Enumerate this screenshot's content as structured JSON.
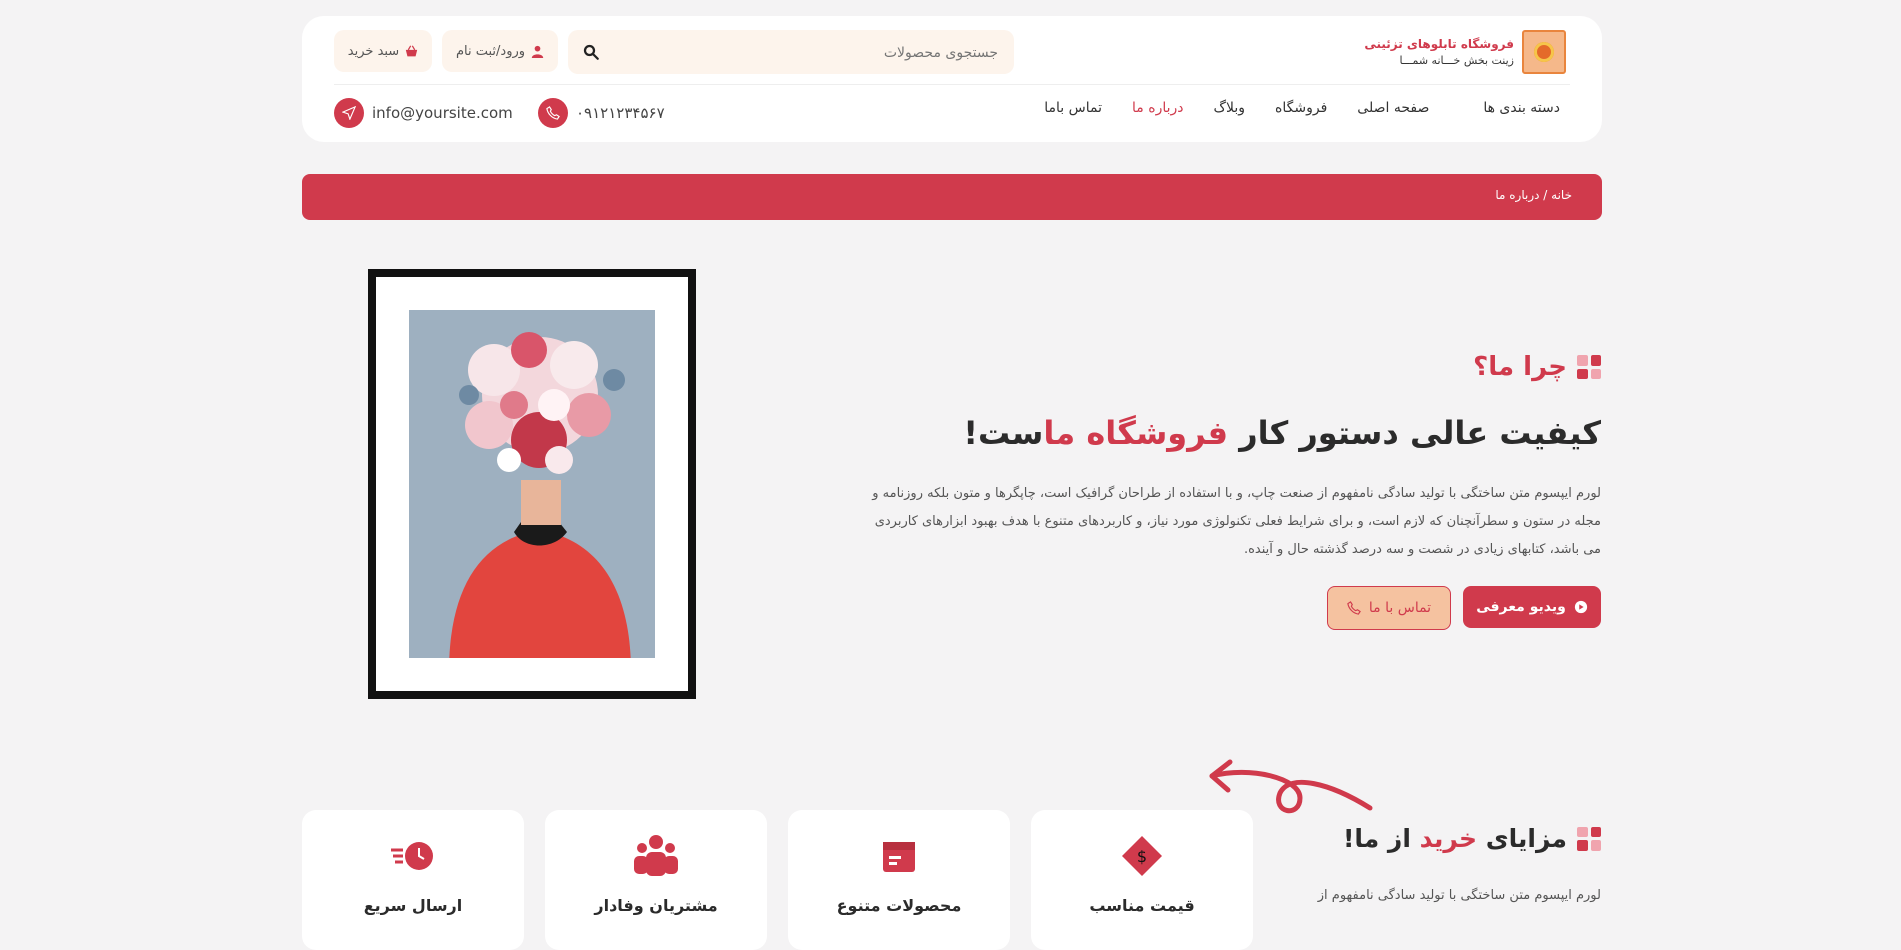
{
  "header": {
    "logo_title": "فروشگاه تابلوهای تزئینی",
    "logo_subtitle": "زینت بخش خـــانه شمـــا",
    "search_placeholder": "جستجوی محصولات",
    "login_label": "ورود/ثبت نام",
    "cart_label": "سبد خرید",
    "nav": [
      {
        "label": "دسته بندی ها",
        "active": false
      },
      {
        "label": "صفحه اصلی",
        "active": false
      },
      {
        "label": "فروشگاه",
        "active": false
      },
      {
        "label": "وبلاگ",
        "active": false
      },
      {
        "label": "درباره ما",
        "active": true
      },
      {
        "label": "تماس باما",
        "active": false
      }
    ],
    "phone": "۰۹۱۲۱۲۳۴۵۶۷",
    "email": "info@yoursite.com"
  },
  "breadcrumb": {
    "text": "خانه / درباره ما"
  },
  "hero": {
    "section_label": "چرا ما؟",
    "heading_prefix": "کیفیت عالی دستور کار ",
    "heading_accent": "فروشگاه ما",
    "heading_suffix": "ست!",
    "description": "لورم ایپسوم متن ساختگی با تولید سادگی نامفهوم از صنعت چاپ، و با استفاده از طراحان گرافیک است، چاپگرها و متون بلکه روزنامه و مجله در ستون و سطرآنچنان که لازم است، و برای شرایط فعلی تکنولوژی مورد نیاز، و کاربردهای متنوع با هدف بهبود ابزارهای کاربردی می باشد، کتابهای زیادی در شصت و سه درصد گذشته حال و آینده.",
    "video_button": "ویدیو معرفی",
    "contact_button": "تماس با ما"
  },
  "features": {
    "title_prefix": "مزایای ",
    "title_accent": "خرید",
    "title_suffix": " از ما!",
    "description": "لورم ایپسوم متن ساختگی با تولید سادگی نامفهوم از",
    "cards": [
      {
        "label": "قیمت مناسب",
        "icon": "price-tag-icon"
      },
      {
        "label": "محصولات متنوع",
        "icon": "box-icon"
      },
      {
        "label": "مشتریان وفادار",
        "icon": "users-icon"
      },
      {
        "label": "ارسال سریع",
        "icon": "fast-clock-icon"
      }
    ]
  },
  "colors": {
    "accent": "#d03a4c",
    "background": "#f4f3f4",
    "soft": "#fdf4ec"
  }
}
